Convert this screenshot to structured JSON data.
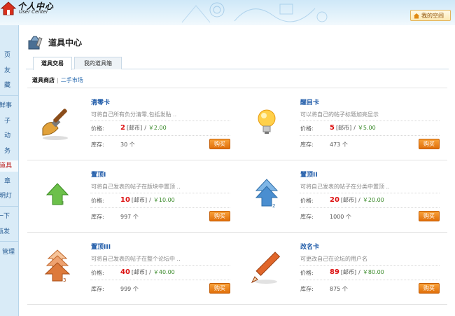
{
  "header": {
    "logo_title": "个人中心",
    "logo_subtitle": "User Center",
    "myspace_label": "我的空间"
  },
  "sidebar": {
    "items": [
      {
        "label": "页"
      },
      {
        "label": "友"
      },
      {
        "label": "藏"
      },
      {
        "label": "鲜事"
      },
      {
        "label": "子"
      },
      {
        "label": "动"
      },
      {
        "label": "务"
      },
      {
        "label": "道具"
      },
      {
        "label": "章"
      },
      {
        "label": "明灯"
      },
      {
        "label": "一下"
      },
      {
        "label": "瓶发"
      },
      {
        "label": "管理"
      }
    ]
  },
  "page": {
    "title": "道具中心",
    "tabs": [
      {
        "label": "道具交易"
      },
      {
        "label": "我的道具箱"
      }
    ],
    "subnav": {
      "current": "道具商店",
      "separator": "|",
      "link": "二手市场"
    }
  },
  "labels": {
    "price": "价格:",
    "stock": "库存:",
    "unit": "[邮币]",
    "slash": "/",
    "buy": "购买"
  },
  "items": [
    {
      "name": "清零卡",
      "desc": "可将自己所有负分清零,包括发贴 ..",
      "coins": "2",
      "yuan": "￥2.00",
      "stock": "30 个",
      "icon": "paintbrush-icon"
    },
    {
      "name": "醒目卡",
      "desc": "可以将自己的帖子标题加亮显示",
      "coins": "5",
      "yuan": "￥5.00",
      "stock": "473 个",
      "icon": "lightbulb-icon"
    },
    {
      "name": "置顶I",
      "desc": "可将自己发表的帖子在版块中置顶 ..",
      "coins": "10",
      "yuan": "￥10.00",
      "stock": "997 个",
      "icon": "arrow-up-green-icon"
    },
    {
      "name": "置顶II",
      "desc": "可将自己发表的帖子在分类中置顶 ..",
      "coins": "20",
      "yuan": "￥20.00",
      "stock": "1000 个",
      "icon": "arrow-up-blue-icon"
    },
    {
      "name": "置顶III",
      "desc": "可将自己发表的帖子在整个论坛中 ..",
      "coins": "40",
      "yuan": "￥40.00",
      "stock": "999 个",
      "icon": "arrow-up-orange-icon"
    },
    {
      "name": "改名卡",
      "desc": "可更改自己在论坛的用户名",
      "coins": "89",
      "yuan": "￥80.00",
      "stock": "875 个",
      "icon": "pencil-icon"
    }
  ],
  "colors": {
    "accent_blue": "#1e5aa8",
    "price_red": "#d11111",
    "price_green": "#3a8a2a",
    "buy_orange": "#e06f0a",
    "sidebar_bg": "#d9ebf7"
  }
}
